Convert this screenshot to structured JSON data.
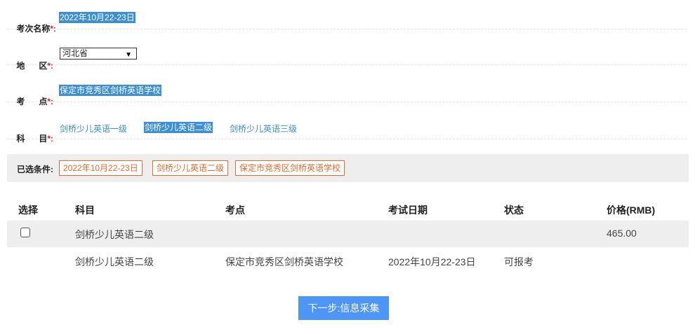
{
  "form": {
    "exam_session": {
      "label": "考次名称",
      "required_mark": "*:",
      "value": "2022年10月22-23日"
    },
    "region": {
      "label": "地      区",
      "required_mark": "*:",
      "value": "河北省"
    },
    "exam_site": {
      "label": "考      点",
      "required_mark": "*:",
      "value": "保定市竞秀区剑桥英语学校"
    },
    "subject": {
      "label": "科      目",
      "required_mark": "*:",
      "options": [
        "剑桥少儿英语一级",
        "剑桥少儿英语二级",
        "剑桥少儿英语三级"
      ],
      "selected": "剑桥少儿英语二级"
    }
  },
  "filters": {
    "label": "已选条件:",
    "tags": [
      "2022年10月22-23日",
      "剑桥少儿英语二级",
      "保定市竞秀区剑桥英语学校"
    ]
  },
  "table": {
    "headers": [
      "选择",
      "科目",
      "考点",
      "考试日期",
      "状态",
      "价格(RMB)"
    ],
    "group_row": {
      "subject": "剑桥少儿英语二级",
      "price": "465.00",
      "checked": false
    },
    "detail_row": {
      "subject": "剑桥少儿英语二级",
      "site": "保定市竞秀区剑桥英语学校",
      "date": "2022年10月22-23日",
      "status": "可报考"
    }
  },
  "actions": {
    "next_label": "下一步:信息采集"
  },
  "colors": {
    "accent": "#3a8fd6",
    "tag_border": "#e86a2e",
    "button": "#4d96f7"
  }
}
